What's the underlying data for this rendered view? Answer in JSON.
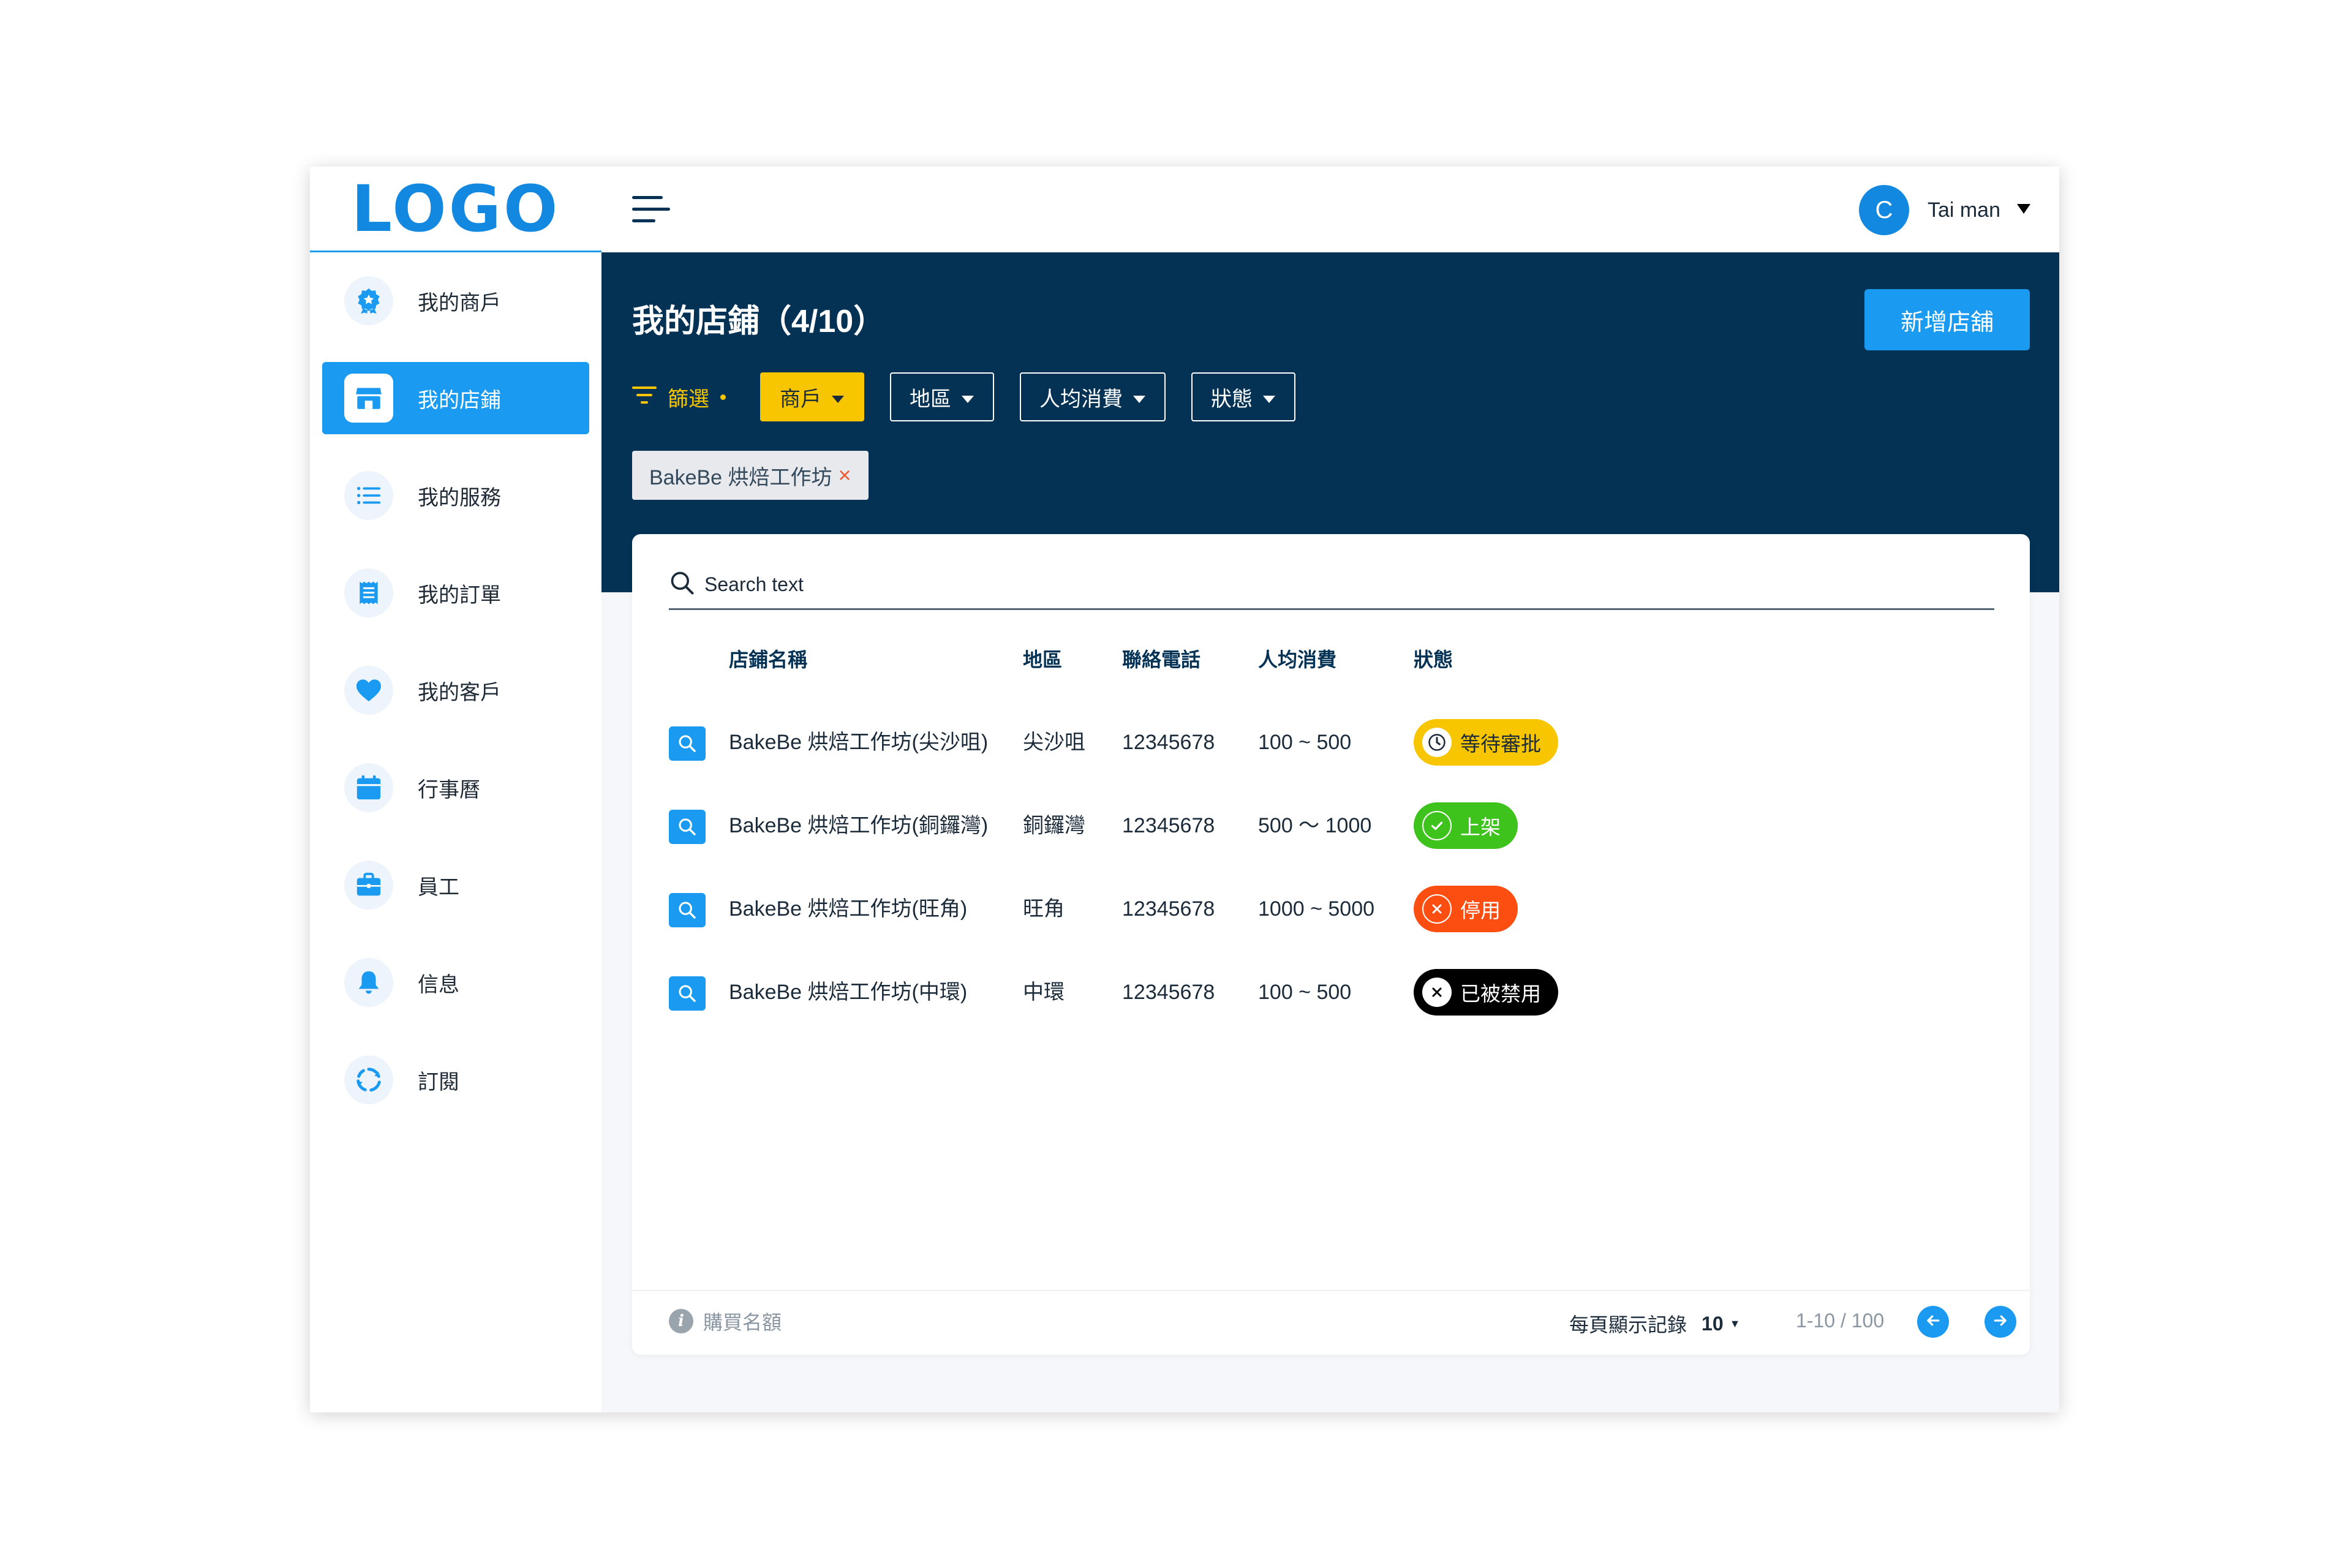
{
  "logo": "LOGO",
  "user": {
    "initial": "C",
    "name": "Tai man"
  },
  "sidebar": {
    "items": [
      {
        "label": "我的商戶",
        "icon": "badge-icon"
      },
      {
        "label": "我的店鋪",
        "icon": "store-icon",
        "active": true
      },
      {
        "label": "我的服務",
        "icon": "list-icon"
      },
      {
        "label": "我的訂單",
        "icon": "receipt-icon"
      },
      {
        "label": "我的客戶",
        "icon": "heart-icon"
      },
      {
        "label": "行事曆",
        "icon": "calendar-icon"
      },
      {
        "label": "員工",
        "icon": "briefcase-icon"
      },
      {
        "label": "信息",
        "icon": "bell-icon"
      },
      {
        "label": "訂閱",
        "icon": "refresh-icon"
      }
    ]
  },
  "header": {
    "title": "我的店鋪（4/10）",
    "add_button": "新增店舖",
    "filter_label": "篩選",
    "filters": [
      {
        "label": "商戶",
        "active": true
      },
      {
        "label": "地區",
        "active": false
      },
      {
        "label": "人均消費",
        "active": false
      },
      {
        "label": "狀態",
        "active": false
      }
    ],
    "active_tag": "BakeBe 烘焙工作坊",
    "tag_remove": "×"
  },
  "search": {
    "placeholder": "Search text"
  },
  "table": {
    "columns": [
      "店鋪名稱",
      "地區",
      "聯絡電話",
      "人均消費",
      "狀態"
    ],
    "rows": [
      {
        "name": "BakeBe 烘焙工作坊(尖沙咀)",
        "district": "尖沙咀",
        "phone": "12345678",
        "spend": "100 ~ 500",
        "status": "等待審批",
        "status_type": "pending"
      },
      {
        "name": "BakeBe 烘焙工作坊(銅鑼灣)",
        "district": "銅鑼灣",
        "phone": "12345678",
        "spend": "500 〜 1000",
        "status": "上架",
        "status_type": "active"
      },
      {
        "name": "BakeBe 烘焙工作坊(旺角)",
        "district": "旺角",
        "phone": "12345678",
        "spend": "1000 ~ 5000",
        "status": "停用",
        "status_type": "disabled"
      },
      {
        "name": "BakeBe 烘焙工作坊(中環)",
        "district": "中環",
        "phone": "12345678",
        "spend": "100 ~ 500",
        "status": "已被禁用",
        "status_type": "banned"
      }
    ]
  },
  "footer": {
    "quota_label": "購買名額",
    "per_page_label": "每頁顯示記錄",
    "per_page_value": "10",
    "range": "1-10 / 100"
  },
  "colors": {
    "primary": "#1a9af1",
    "navy": "#033254",
    "filter_yellow": "#f7c600",
    "pending": "#f7c600",
    "active": "#3ec21c",
    "disabled": "#fd4e12",
    "banned": "#000000"
  }
}
